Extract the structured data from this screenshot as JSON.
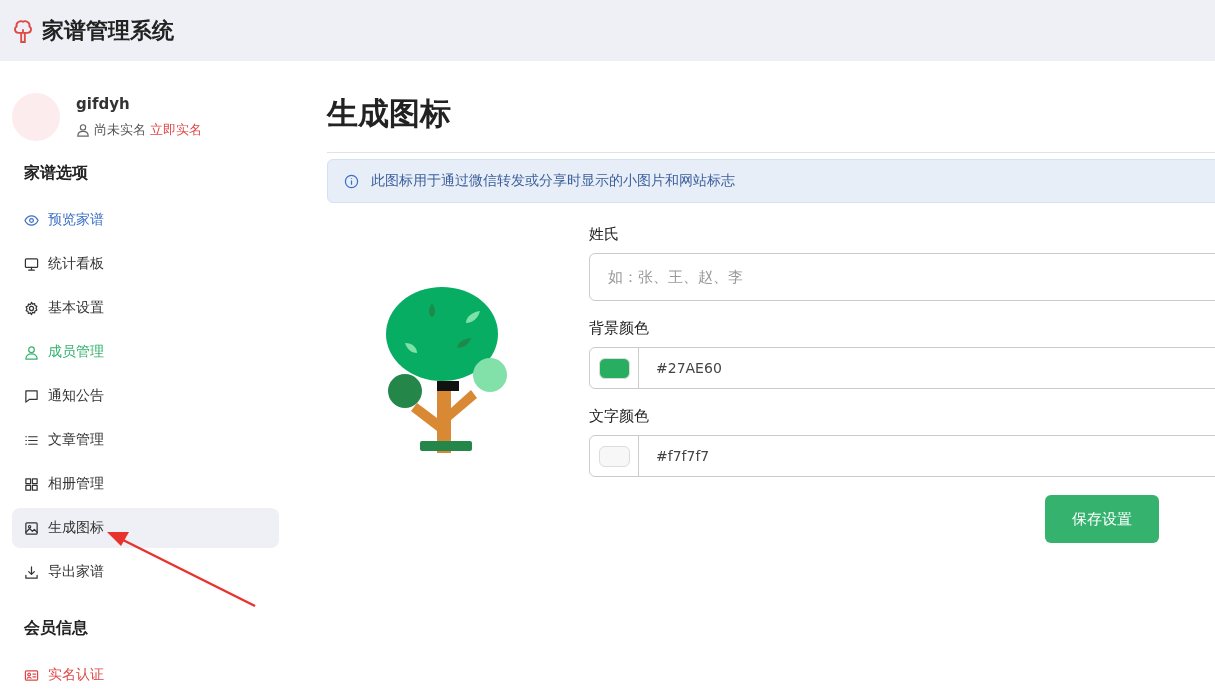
{
  "header": {
    "title": "家谱管理系统"
  },
  "user": {
    "name": "gifdyh",
    "status": "尚未实名",
    "verify_link": "立即实名"
  },
  "sidebar": {
    "sections": [
      {
        "title": "家谱选项",
        "items": [
          {
            "label": "预览家谱",
            "kind": "eye",
            "selected": false,
            "color": "#3b6fc4"
          },
          {
            "label": "统计看板",
            "kind": "monitor",
            "selected": false,
            "color": "#333333"
          },
          {
            "label": "基本设置",
            "kind": "gear",
            "selected": false,
            "color": "#333333"
          },
          {
            "label": "成员管理",
            "kind": "person",
            "selected": false,
            "color": "#34b26e"
          },
          {
            "label": "通知公告",
            "kind": "chat",
            "selected": false,
            "color": "#333333"
          },
          {
            "label": "文章管理",
            "kind": "list",
            "selected": false,
            "color": "#333333"
          },
          {
            "label": "相册管理",
            "kind": "grid",
            "selected": false,
            "color": "#333333"
          },
          {
            "label": "生成图标",
            "kind": "image",
            "selected": true,
            "color": "#333333"
          },
          {
            "label": "导出家谱",
            "kind": "download",
            "selected": false,
            "color": "#333333"
          }
        ]
      },
      {
        "title": "会员信息",
        "items": [
          {
            "label": "实名认证",
            "kind": "idcard",
            "selected": false,
            "color": "#e04848"
          }
        ]
      }
    ]
  },
  "page": {
    "title": "生成图标",
    "notice": "此图标用于通过微信转发或分享时显示的小图片和网站标志",
    "fields": [
      {
        "kind": "text",
        "label": "姓氏",
        "placeholder": "如：张、王、赵、李"
      },
      {
        "kind": "color",
        "label": "背景颜色",
        "value": "#27AE60"
      },
      {
        "kind": "color",
        "label": "文字颜色",
        "value": "#f7f7f7"
      }
    ],
    "save_button": "保存设置"
  }
}
